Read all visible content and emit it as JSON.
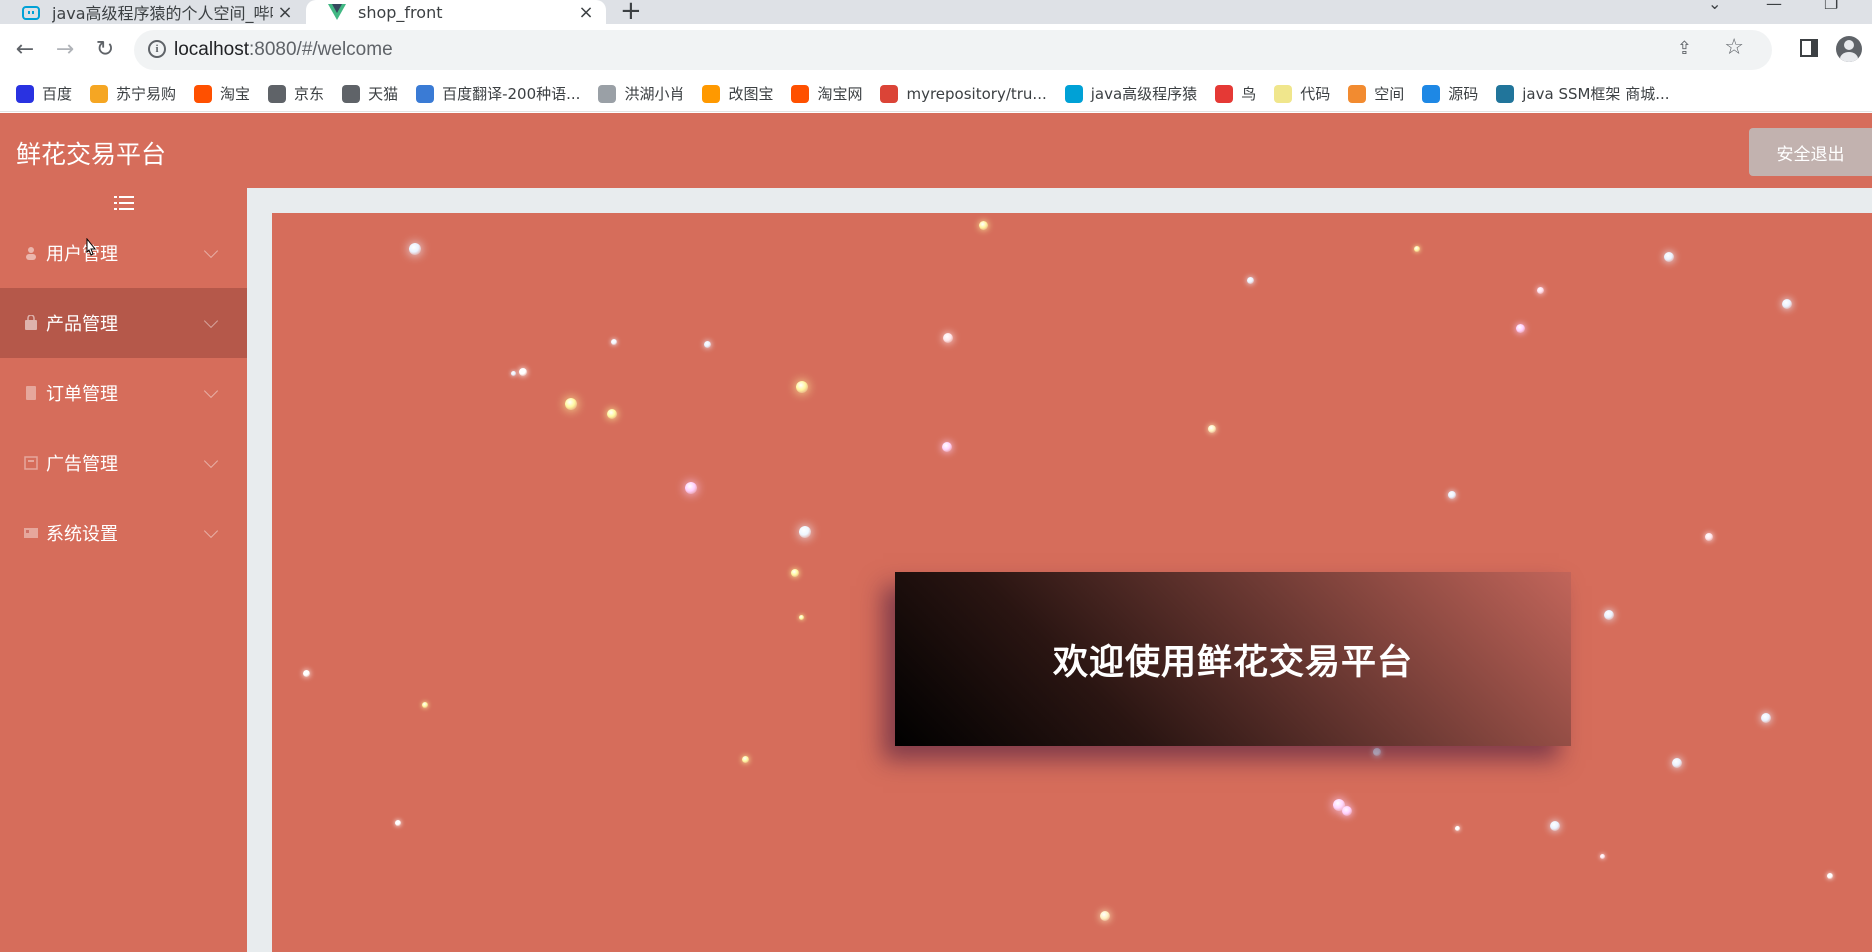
{
  "browser": {
    "tabs": [
      {
        "title": "java高级程序猿的个人空间_哔哩",
        "favicon": "bilibili-icon",
        "active": false
      },
      {
        "title": "shop_front",
        "favicon": "vue-icon",
        "active": true
      }
    ],
    "new_tab_label": "+",
    "close_label": "×",
    "url_host": "localhost",
    "url_rest": ":8080/#/welcome",
    "bookmarks": [
      {
        "label": "百度",
        "icon": "baidu-icon",
        "color": "#2932e1"
      },
      {
        "label": "苏宁易购",
        "icon": "suning-icon",
        "color": "#f5a623"
      },
      {
        "label": "淘宝",
        "icon": "taobao-icon",
        "color": "#ff5000"
      },
      {
        "label": "京东",
        "icon": "globe-icon",
        "color": "#5f6368"
      },
      {
        "label": "天猫",
        "icon": "globe-icon",
        "color": "#5f6368"
      },
      {
        "label": "百度翻译-200种语...",
        "icon": "translate-icon",
        "color": "#3a7bd5"
      },
      {
        "label": "洪湖小肖",
        "icon": "bird-icon",
        "color": "#9aa0a6"
      },
      {
        "label": "改图宝",
        "icon": "gaitubao-icon",
        "color": "#ff9900"
      },
      {
        "label": "淘宝网",
        "icon": "taobao-icon",
        "color": "#ff5000"
      },
      {
        "label": "myrepository/tru...",
        "icon": "chrome-icon",
        "color": "#db4437"
      },
      {
        "label": "java高级程序猿",
        "icon": "bilibili-icon",
        "color": "#00a1d6"
      },
      {
        "label": "鸟",
        "icon": "bird-icon",
        "color": "#e53935"
      },
      {
        "label": "代码",
        "icon": "code-icon",
        "color": "#f0e68c"
      },
      {
        "label": "空间",
        "icon": "space-icon",
        "color": "#f28b30"
      },
      {
        "label": "源码",
        "icon": "source-icon",
        "color": "#1e88e5"
      },
      {
        "label": "java SSM框架 商城...",
        "icon": "wordpress-icon",
        "color": "#21759b"
      }
    ]
  },
  "app": {
    "brand": "鲜花交易平台",
    "logout_label": "安全退出",
    "menu": [
      {
        "label": "用户管理",
        "icon": "users-icon",
        "active": false
      },
      {
        "label": "产品管理",
        "icon": "bag-icon",
        "active": true
      },
      {
        "label": "订单管理",
        "icon": "order-icon",
        "active": false
      },
      {
        "label": "广告管理",
        "icon": "ad-icon",
        "active": false
      },
      {
        "label": "系统设置",
        "icon": "settings-icon",
        "active": false
      }
    ],
    "welcome_text": "欢迎使用鲜花交易平台",
    "colors": {
      "theme": "#d66d5b",
      "active_menu": "#b5584a",
      "frame": "#e8ecee"
    }
  }
}
